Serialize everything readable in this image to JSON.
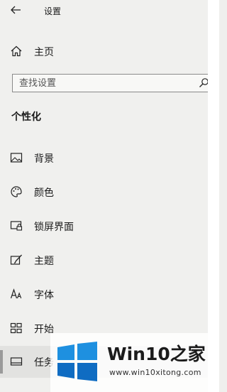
{
  "window": {
    "title": "设置"
  },
  "home": {
    "label": "主页"
  },
  "search": {
    "placeholder": "查找设置"
  },
  "section": {
    "title": "个性化"
  },
  "nav": [
    {
      "label": "背景",
      "icon": "picture-icon"
    },
    {
      "label": "颜色",
      "icon": "palette-icon"
    },
    {
      "label": "锁屏界面",
      "icon": "lock-screen-icon"
    },
    {
      "label": "主题",
      "icon": "brush-icon"
    },
    {
      "label": "字体",
      "icon": "font-icon"
    },
    {
      "label": "开始",
      "icon": "start-tiles-icon"
    }
  ],
  "taskbar_item": {
    "label": "任务",
    "selected": true
  },
  "watermark": {
    "brand": "Win10之家",
    "url": "www.win10xitong.com",
    "flag_colors": [
      "#1e90e0",
      "#0f6cc2"
    ]
  },
  "colors": {
    "background": "#f0f0ee",
    "selected_bg": "#e2e2e0",
    "accent_bar": "#9a9a9a"
  }
}
